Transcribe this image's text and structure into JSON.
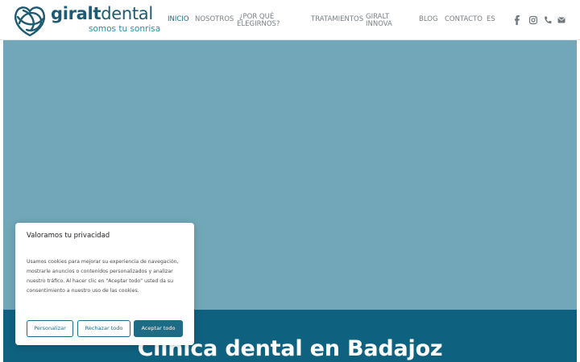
{
  "header": {
    "logo": {
      "name_bold": "giralt",
      "name_regular": "dental",
      "tagline": "somos tu sonrisa"
    },
    "nav": {
      "inicio": "INICIO",
      "nosotros": "NOSOTROS",
      "por_que_1": "¿POR QUÉ",
      "por_que_2": "ELEGIRNOS?",
      "tratamientos": "TRATAMIENTOS",
      "giralt_1": "GIRALT",
      "giralt_2": "INNOVA",
      "blog": "BLOG",
      "contacto": "CONTACTO",
      "lang": "ES"
    },
    "social_icons": [
      "facebook-icon",
      "instagram-icon",
      "phone-icon",
      "mail-icon"
    ]
  },
  "hero": {
    "title": "Clínica dental en Badajoz"
  },
  "cookie_banner": {
    "title": "Valoramos tu privacidad",
    "text": "Usamos cookies para mejorar su experiencia de navegación, mostrarle anuncios o contenidos personalizados y analizar nuestro tráfico. Al hacer clic en \"Aceptar todo\" usted da su consentimiento a nuestro uso de las cookies.",
    "buttons": {
      "customize": "Personalizar",
      "reject": "Rechazar todo",
      "accept": "Aceptar todo"
    }
  },
  "colors": {
    "brand": "#1d6b85",
    "hero_bg": "#71a7b8",
    "band_bg": "#0f6180",
    "nav_text": "#777f85"
  }
}
